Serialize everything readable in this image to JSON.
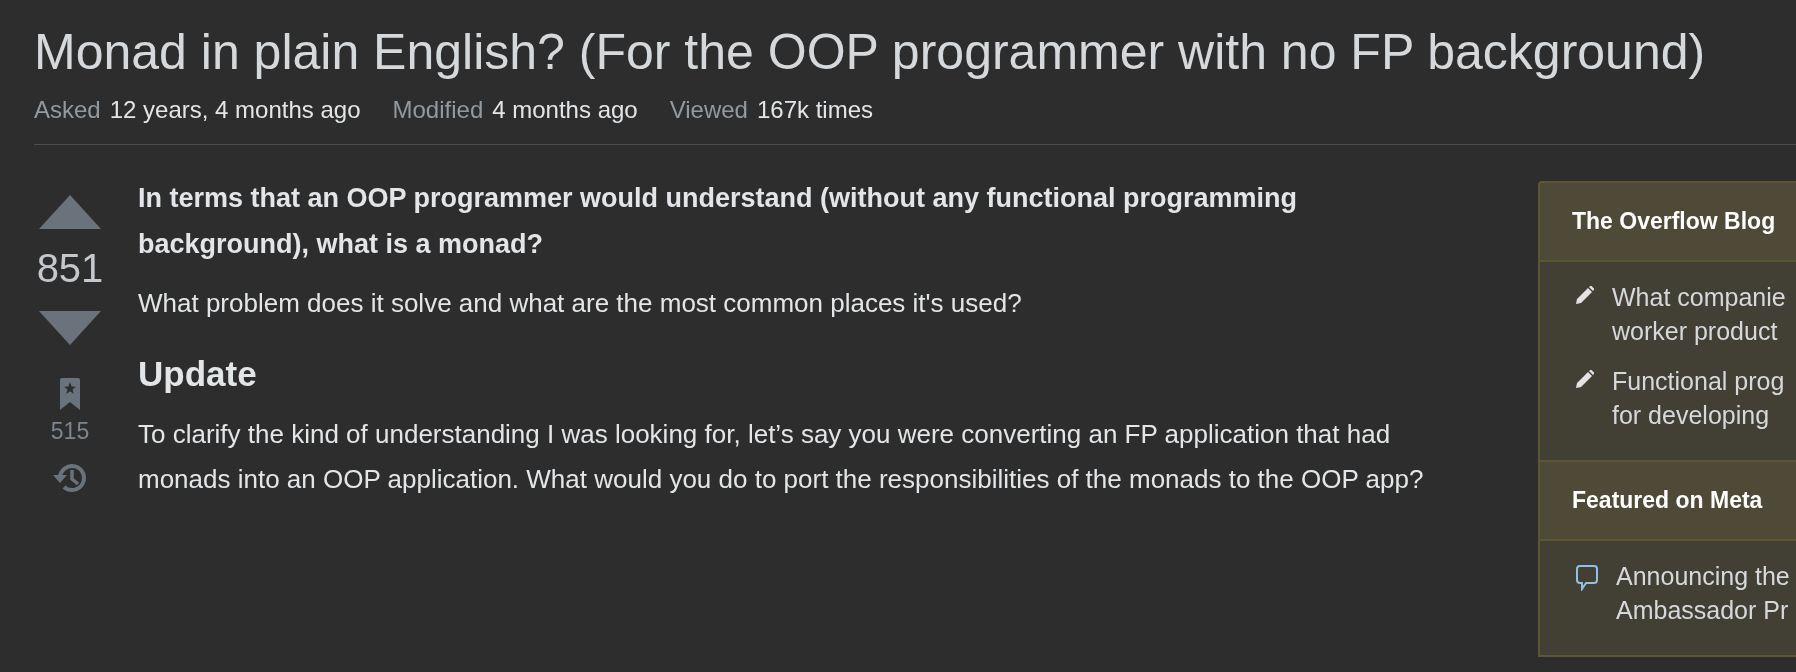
{
  "question": {
    "title": "Monad in plain English? (For the OOP programmer with no FP background)",
    "meta": [
      {
        "label": "Asked",
        "value": "12 years, 4 months ago"
      },
      {
        "label": "Modified",
        "value": "4 months ago"
      },
      {
        "label": "Viewed",
        "value": "167k times"
      }
    ],
    "score": "851",
    "bookmarks": "515",
    "body": [
      {
        "kind": "lead",
        "text": "In terms that an OOP programmer would understand (without any functional programming background), what is a monad?"
      },
      {
        "kind": "paragraph",
        "text": "What problem does it solve and what are the most common places it's used?"
      },
      {
        "kind": "heading",
        "text": "Update"
      },
      {
        "kind": "paragraph",
        "text": "To clarify the kind of understanding I was looking for, let’s say you were converting an FP application that had monads into an OOP application. What would you do to port the responsibilities of the monads to the OOP app?"
      }
    ]
  },
  "sidebar": [
    {
      "title": "The Overflow Blog",
      "items": [
        {
          "kind": "pencil",
          "lines": [
            "What companie",
            "worker product"
          ]
        },
        {
          "kind": "pencil",
          "lines": [
            "Functional prog",
            "for developing"
          ]
        }
      ]
    },
    {
      "title": "Featured on Meta",
      "items": [
        {
          "kind": "chat",
          "lines": [
            "Announcing the",
            "Ambassador Pr"
          ]
        }
      ]
    }
  ]
}
